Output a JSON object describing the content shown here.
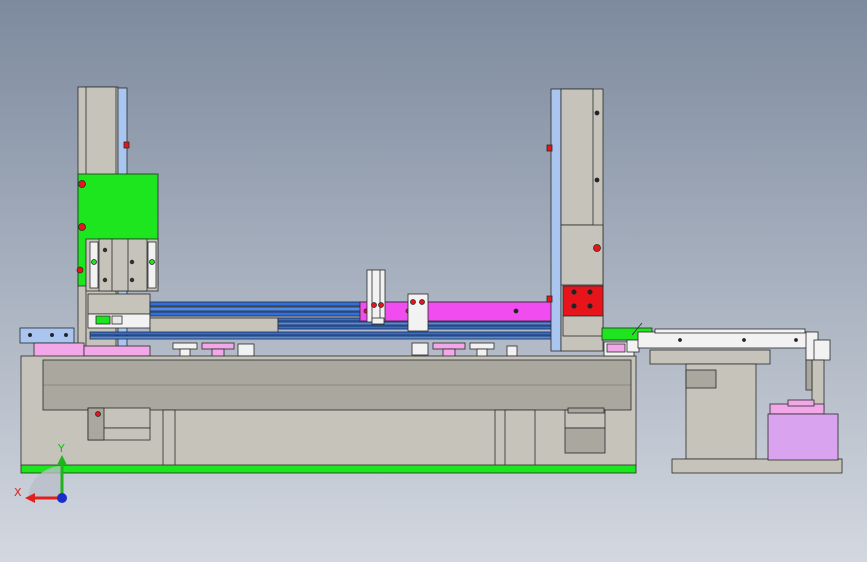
{
  "view": {
    "background_top": "#7d8a9e",
    "background_bottom": "#d3d8e0"
  },
  "triad": {
    "x_label": "X",
    "y_label": "Y",
    "x_color": "#e0201c",
    "y_color": "#1fb41f",
    "z_color": "#1c2cc8"
  },
  "colors": {
    "frame_gray": "#c6c4ba",
    "frame_gray_dark": "#a9a79e",
    "edge": "#2a2a2a",
    "green": "#1ee61e",
    "blue_rail": "#2f6fe0",
    "blue_rail_light": "#4d8df0",
    "magenta": "#f04cf0",
    "pink": "#f2a8e8",
    "violet": "#d9a3f0",
    "red": "#e8141c",
    "white_part": "#f2f2f2",
    "light_blue": "#aac6f0"
  }
}
